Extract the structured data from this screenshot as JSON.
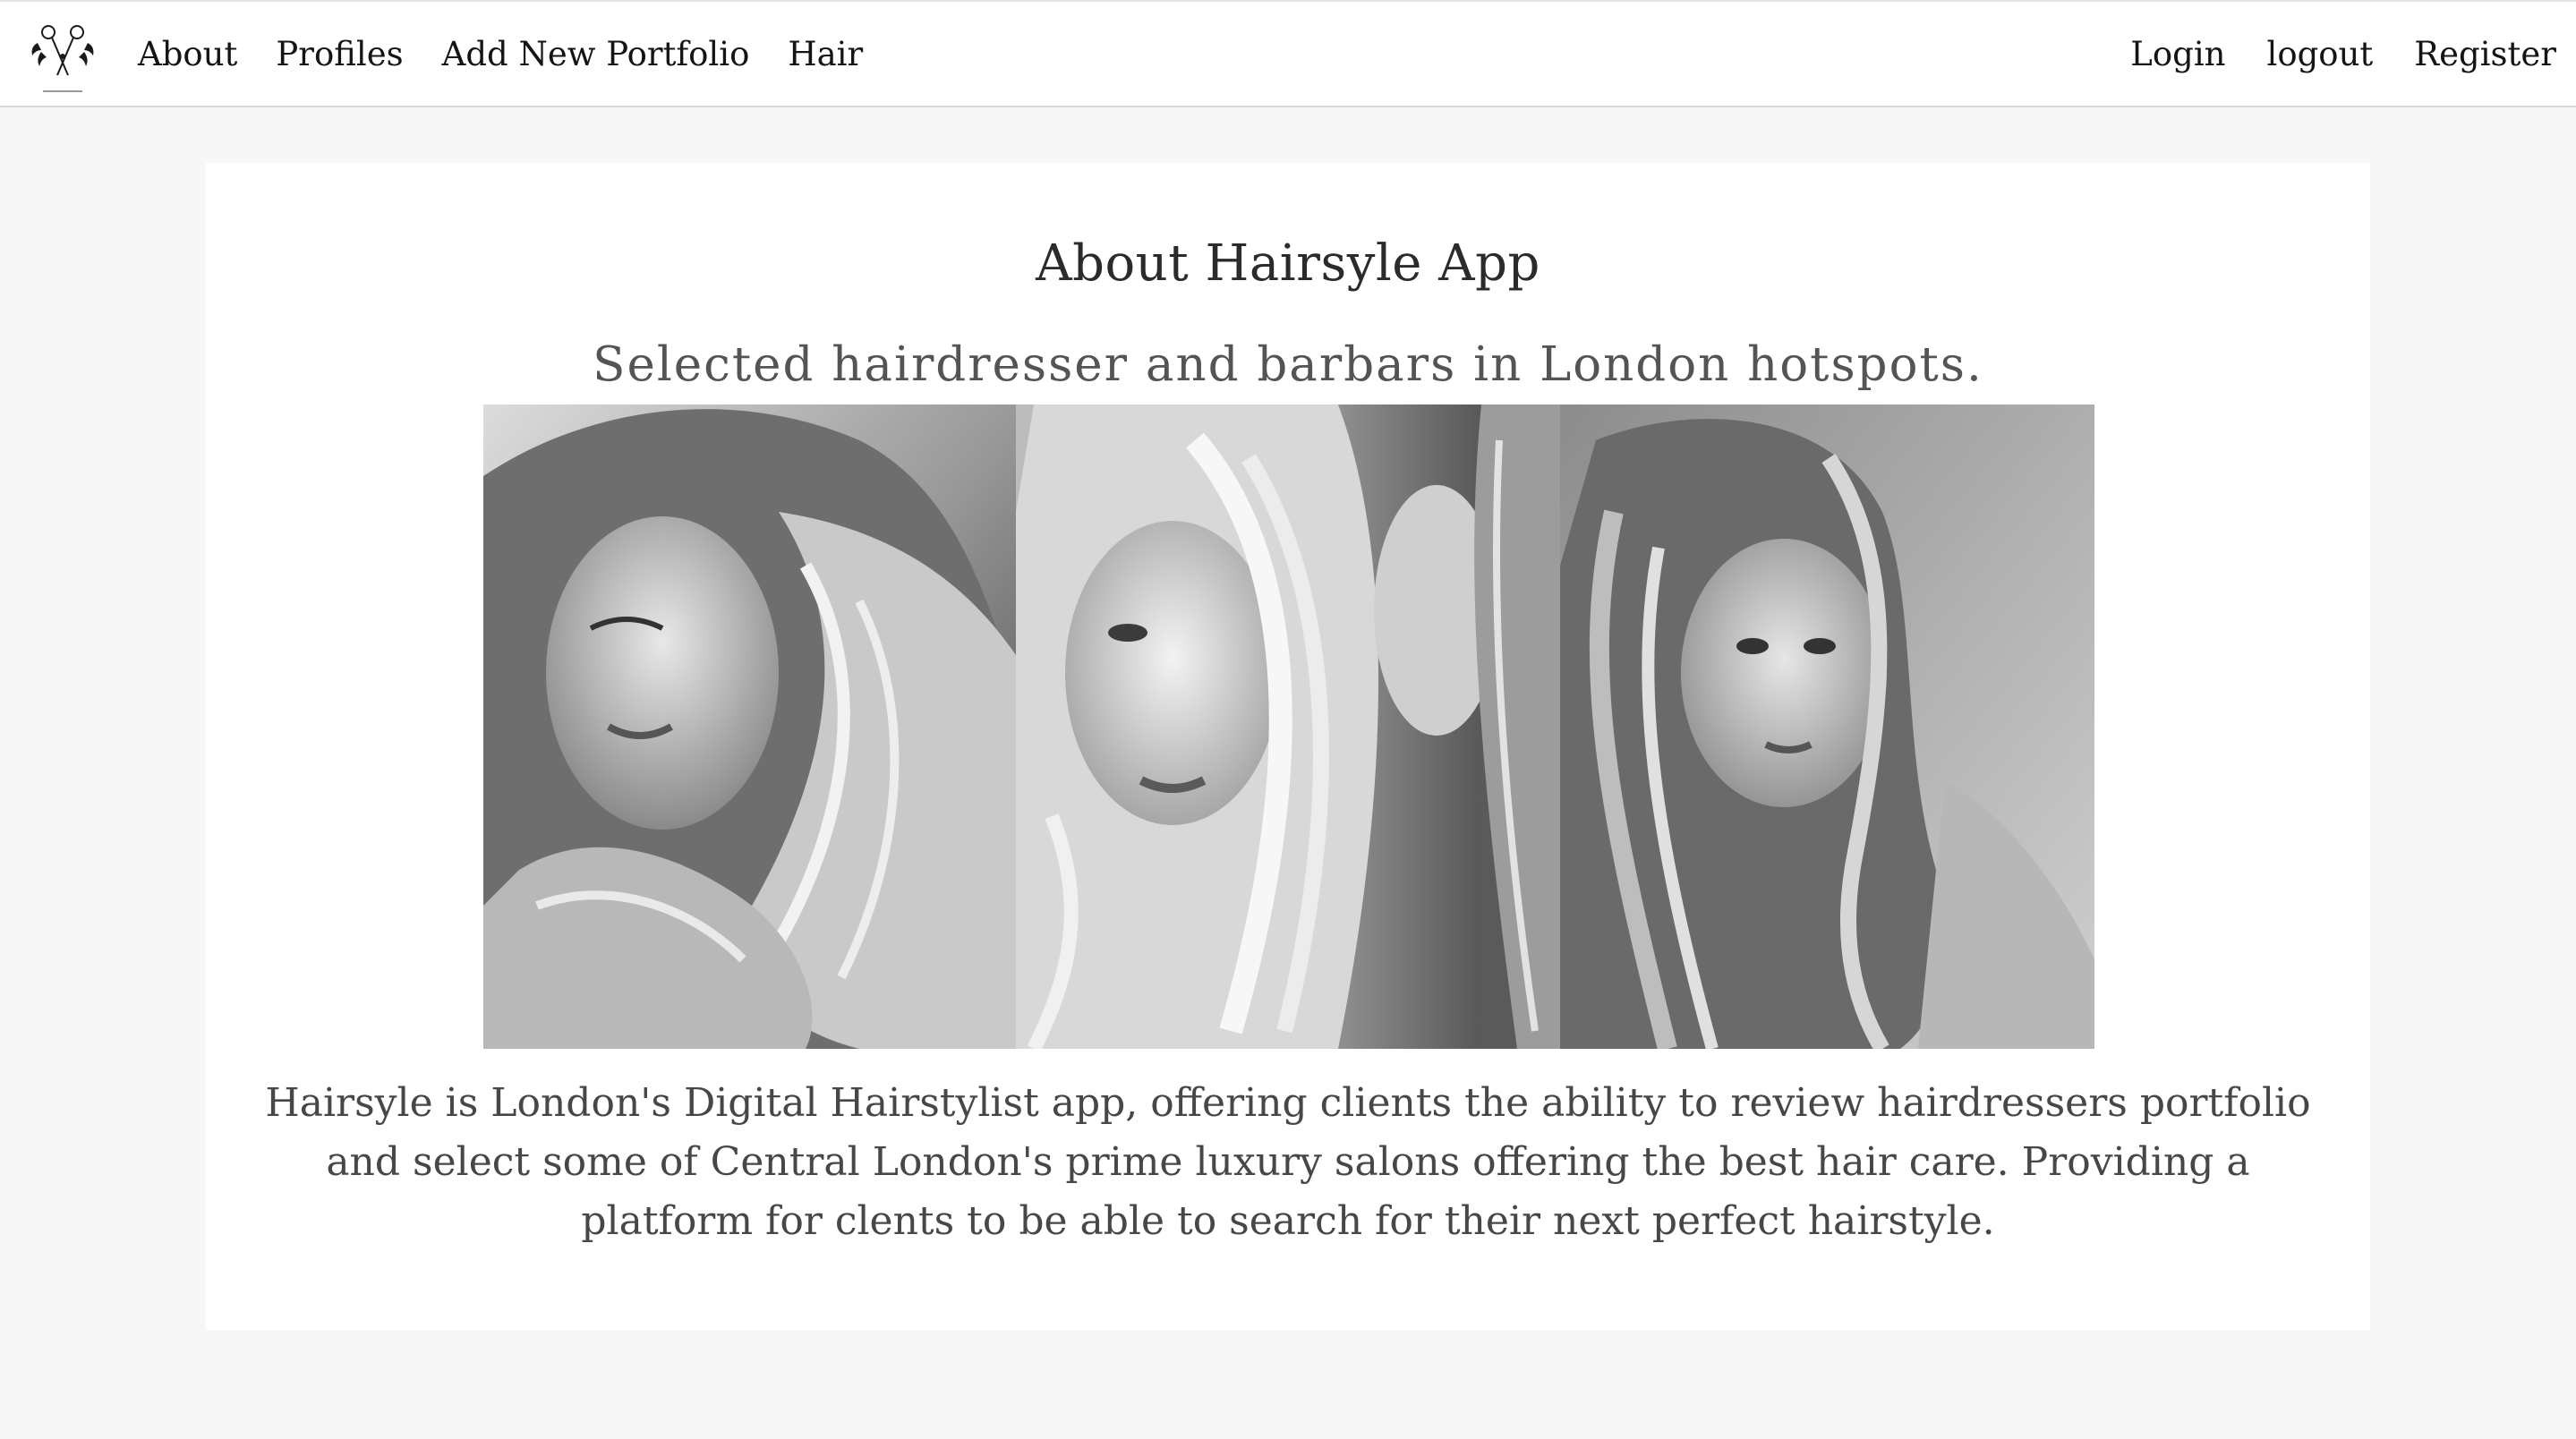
{
  "navbar": {
    "logo_icon": "scissors-logo-icon",
    "left_links": [
      {
        "label": "About"
      },
      {
        "label": "Profiles"
      },
      {
        "label": "Add New Portfolio"
      },
      {
        "label": "Hair"
      }
    ],
    "right_links": [
      {
        "label": "Login"
      },
      {
        "label": "logout"
      },
      {
        "label": "Register"
      }
    ]
  },
  "main": {
    "title": "About Hairsyle App",
    "subtitle": "Selected hairdresser and barbars in London hotspots.",
    "description": "Hairsyle is London's Digital Hairstylist app, offering clients the ability to review hairdressers portfolio and select some of Central London's prime luxury salons offering the best hair care. Providing a platform for clents to be able to search for their next perfect hairstyle."
  },
  "colors": {
    "page_background": "#f7f7f7",
    "card_background": "#ffffff",
    "nav_text": "#141414",
    "title_text": "#2b2b2b",
    "body_text": "#474747"
  }
}
